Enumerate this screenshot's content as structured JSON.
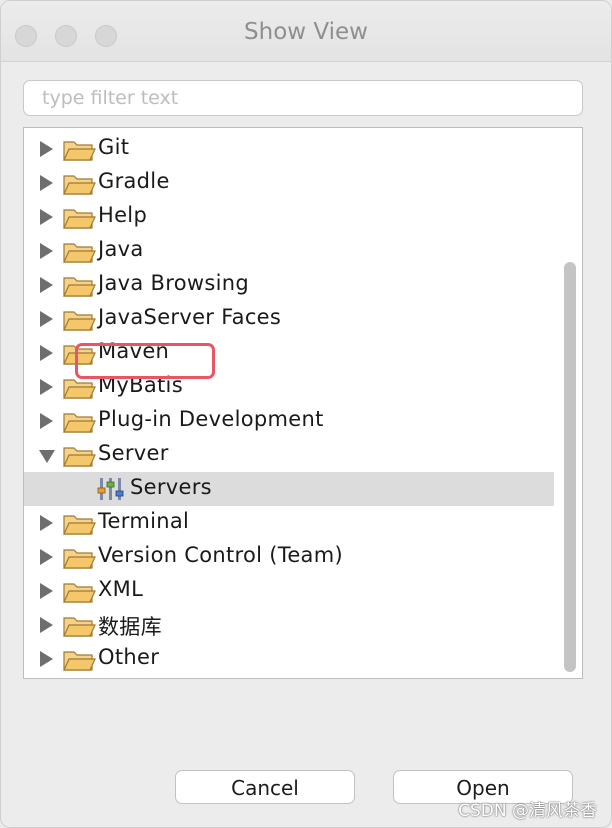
{
  "window": {
    "title": "Show View"
  },
  "filter": {
    "placeholder": "type filter text",
    "value": ""
  },
  "tree": {
    "items": [
      {
        "label": "Git",
        "expanded": false
      },
      {
        "label": "Gradle",
        "expanded": false
      },
      {
        "label": "Help",
        "expanded": false
      },
      {
        "label": "Java",
        "expanded": false
      },
      {
        "label": "Java Browsing",
        "expanded": false
      },
      {
        "label": "JavaServer Faces",
        "expanded": false
      },
      {
        "label": "Maven",
        "expanded": false
      },
      {
        "label": "MyBatis",
        "expanded": false
      },
      {
        "label": "Plug-in Development",
        "expanded": false
      },
      {
        "label": "Server",
        "expanded": true
      },
      {
        "label": "Servers",
        "child": true,
        "selected": true,
        "icon": "servers-view-icon"
      },
      {
        "label": "Terminal",
        "expanded": false
      },
      {
        "label": "Version Control (Team)",
        "expanded": false
      },
      {
        "label": "XML",
        "expanded": false
      },
      {
        "label": "数据库",
        "expanded": false
      },
      {
        "label": "Other",
        "expanded": false
      }
    ]
  },
  "buttons": {
    "cancel_label": "Cancel",
    "open_label": "Open"
  },
  "watermark": {
    "text": "CSDN @清风茶香"
  },
  "colors": {
    "highlight": "#ea5565",
    "selection": "#dcdcdc",
    "folder": "#f3c76a"
  }
}
